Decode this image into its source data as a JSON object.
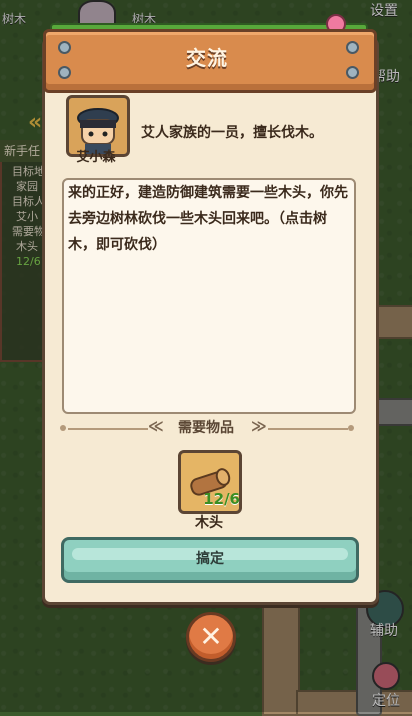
{
  "hud": {
    "top_left_label": "树木",
    "top_mid_label": "树木",
    "settings_label": "设置",
    "help_label": "帮助",
    "assist_label": "辅助",
    "locate_label": "定位"
  },
  "quest_panel": {
    "title": "新手任",
    "lines": [
      "目标地",
      "家园",
      "目标人",
      "艾小",
      "需要物",
      "木头"
    ],
    "progress": "12/6"
  },
  "dialog": {
    "title": "交流",
    "npc_name": "艾小森",
    "npc_desc": "艾人家族的一员，擅长伐木。",
    "message": "来的正好，建造防御建筑需要一些木头，你先去旁边树林砍伐一些木头回来吧。（点击树木，即可砍伐）",
    "required_label": "需要物品",
    "chevron_left": "≪",
    "chevron_right": "≫",
    "item_name": "木头",
    "item_count": "12/6",
    "confirm_label": "搞定",
    "close_glyph": "✕"
  },
  "colors": {
    "panel_bg": "#f6ead3",
    "header_orange": "#d98b4d",
    "button_teal": "#8fd0c0",
    "count_green": "#3c8e22"
  }
}
